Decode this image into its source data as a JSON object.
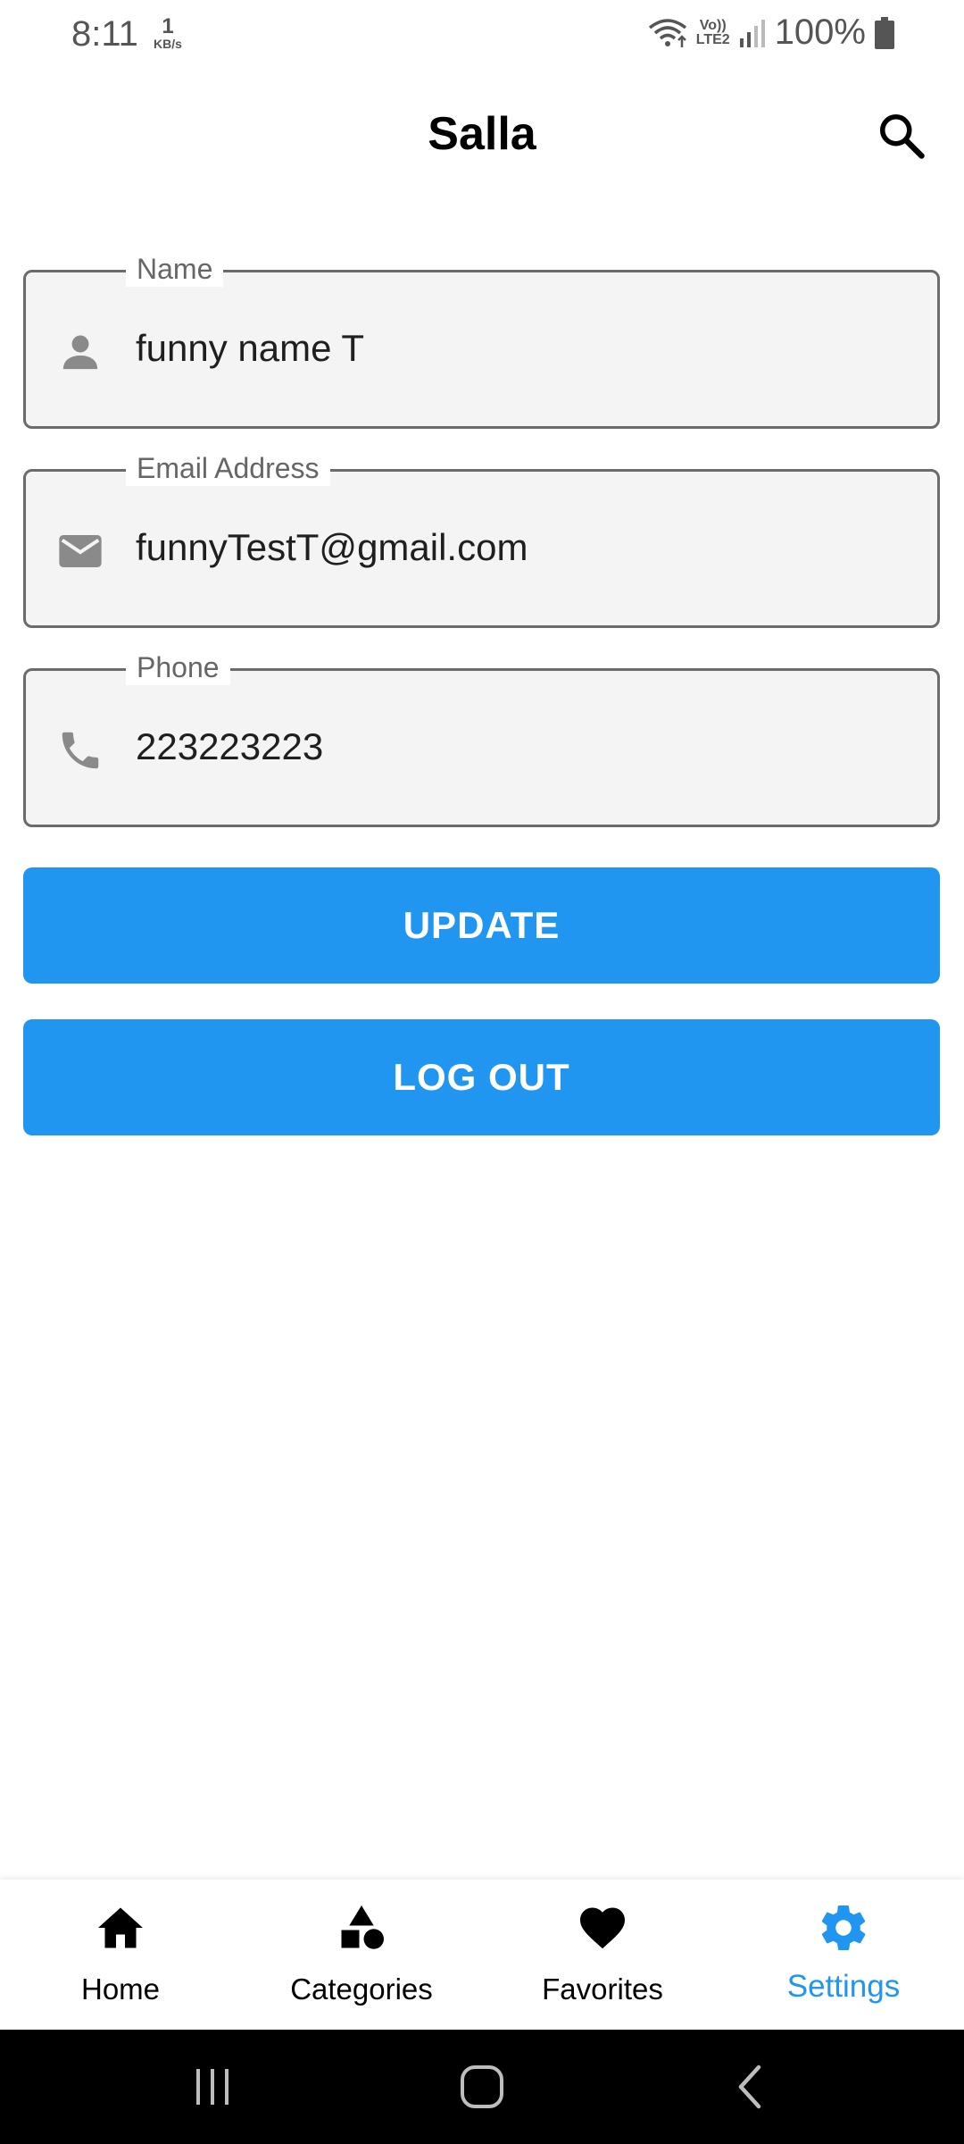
{
  "status_bar": {
    "time": "8:11",
    "net_speed_value": "1",
    "net_speed_unit": "KB/s",
    "volte_top": "Vo))",
    "volte_bottom": "LTE2",
    "battery": "100%"
  },
  "app_bar": {
    "title": "Salla",
    "search_icon": "search-icon"
  },
  "form": {
    "name": {
      "label": "Name",
      "value": "funny name T",
      "icon": "person-icon"
    },
    "email": {
      "label": "Email Address",
      "value": "funnyTestT@gmail.com",
      "icon": "mail-icon"
    },
    "phone": {
      "label": "Phone",
      "value": "223223223",
      "icon": "phone-icon"
    }
  },
  "buttons": {
    "update": "UPDATE",
    "logout": "LOG OUT"
  },
  "bottom_nav": {
    "items": [
      {
        "label": "Home",
        "icon": "home-icon",
        "active": false
      },
      {
        "label": "Categories",
        "icon": "categories-icon",
        "active": false
      },
      {
        "label": "Favorites",
        "icon": "heart-icon",
        "active": false
      },
      {
        "label": "Settings",
        "icon": "gear-icon",
        "active": true
      }
    ]
  },
  "colors": {
    "accent": "#2196F0",
    "field_border": "#6B6B6B",
    "field_background": "#F4F4F4",
    "icon_gray": "#8A8A8A"
  }
}
